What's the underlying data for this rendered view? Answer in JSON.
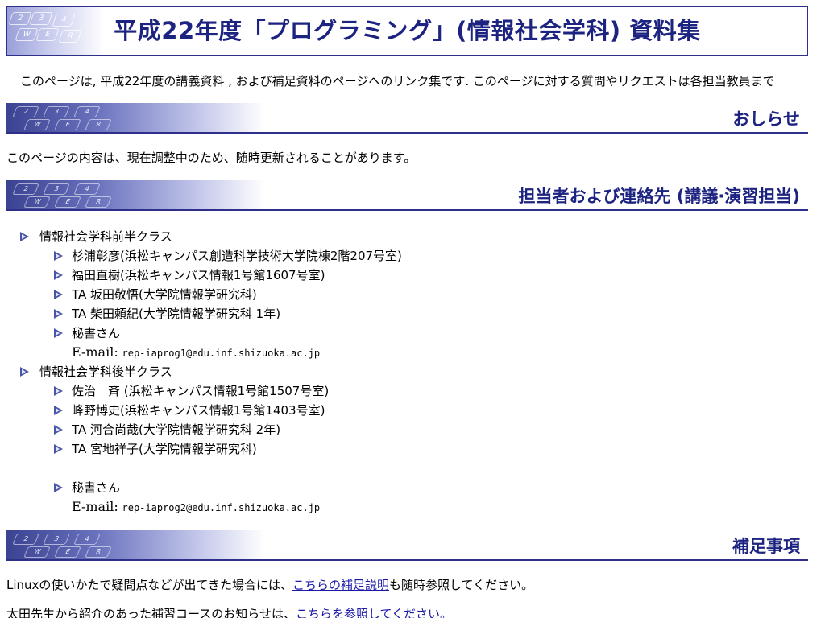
{
  "page": {
    "title": "平成22年度「プログラミング」(情報社会学科) 資料集",
    "intro": "このページは, 平成22年度の講義資料 ,  および補足資料のページへのリンク集です.      このページに対する質問やリクエストは各担当教員まで"
  },
  "keyboard_keys": [
    "2",
    "W",
    "3",
    "E",
    "4",
    "R"
  ],
  "sections": {
    "notice": {
      "heading": "おしらせ",
      "text": "このページの内容は、現在調整中のため、随時更新されることがあります。"
    },
    "contacts": {
      "heading": "担当者および連絡先 (講議·演習担当)",
      "classes": [
        {
          "name": "情報社会学科前半クラス",
          "members": [
            "杉浦彰彦(浜松キャンパス創造科学技術大学院棟2階207号室)",
            "福田直樹(浜松キャンパス情報1号館1607号室)",
            "TA 坂田敬悟(大学院情報学研究科)",
            "TA 柴田頼紀(大学院情報学研究科 1年)",
            "秘書さん"
          ],
          "email_label": "E-mail:",
          "email": "rep-iaprog1@edu.inf.shizuoka.ac.jp"
        },
        {
          "name": "情報社会学科後半クラス",
          "members": [
            "佐治　斉 (浜松キャンパス情報1号館1507号室)",
            "峰野博史(浜松キャンパス情報1号館1403号室)",
            "TA 河合尚哉(大学院情報学研究科 2年)",
            "TA 宮地祥子(大学院情報学研究科)",
            "秘書さん"
          ],
          "email_label": "E-mail:",
          "email": "rep-iaprog2@edu.inf.shizuoka.ac.jp"
        }
      ]
    },
    "supplement": {
      "heading": "補足事項",
      "line1_before": "Linuxの使いかたで疑問点などが出てきた場合には、",
      "line1_link": "こちらの補足説明",
      "line1_after": "も随時参照してください。",
      "line2_before": "太田先生から紹介のあった補習コースのお知らせは、",
      "line2_link": "こちらを参照してください。"
    }
  },
  "colors": {
    "accent": "#1d2380",
    "rule": "#2d2f8a",
    "link": "#1a1aa6"
  }
}
